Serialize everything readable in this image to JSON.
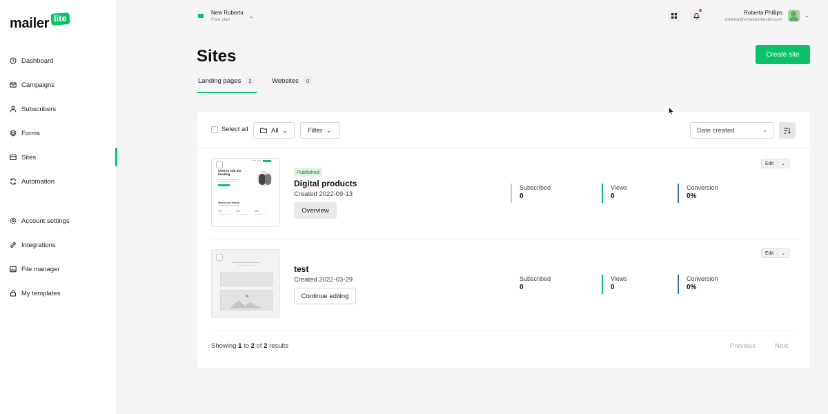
{
  "logo": {
    "text": "mailer",
    "badge": "lite"
  },
  "sidebar": {
    "items": [
      {
        "label": "Dashboard",
        "icon": "clock-icon"
      },
      {
        "label": "Campaigns",
        "icon": "mail-icon"
      },
      {
        "label": "Subscribers",
        "icon": "user-icon"
      },
      {
        "label": "Forms",
        "icon": "layers-icon"
      },
      {
        "label": "Sites",
        "icon": "browser-icon"
      },
      {
        "label": "Automation",
        "icon": "refresh-icon"
      },
      {
        "label": "Account settings",
        "icon": "gear-icon"
      },
      {
        "label": "Integrations",
        "icon": "link-icon"
      },
      {
        "label": "File manager",
        "icon": "image-icon"
      },
      {
        "label": "My templates",
        "icon": "lock-icon"
      }
    ],
    "active": "Sites"
  },
  "workspace": {
    "name": "New Roberta",
    "plan": "Free plan"
  },
  "user": {
    "name": "Roberta Phillips",
    "email": "roberta@emailtooltester.com"
  },
  "page": {
    "title": "Sites",
    "create_button": "Create site"
  },
  "tabs": [
    {
      "label": "Landing pages",
      "count": "2",
      "active": true
    },
    {
      "label": "Websites",
      "count": "0",
      "active": false
    }
  ],
  "toolbar": {
    "select_all": "Select all",
    "folder_filter": "All",
    "filter": "Filter",
    "sort_select": "Date created"
  },
  "sites": [
    {
      "status": "Published",
      "name": "Digital products",
      "created": "Created 2022-09-13",
      "action": "Overview",
      "stats": [
        {
          "label": "Subscribed",
          "value": "0"
        },
        {
          "label": "Views",
          "value": "0"
        },
        {
          "label": "Conversion",
          "value": "0%"
        }
      ],
      "edit": "Edit",
      "thumb_heading": "Click to edit the heading",
      "thumb_sub": "How to use blocks"
    },
    {
      "status": "",
      "name": "test",
      "created": "Created 2022-03-29",
      "action": "Continue editing",
      "stats": [
        {
          "label": "Subscribed",
          "value": "0"
        },
        {
          "label": "Views",
          "value": "0"
        },
        {
          "label": "Conversion",
          "value": "0%"
        }
      ],
      "edit": "Edit"
    }
  ],
  "footer": {
    "showing_prefix": "Showing",
    "from": "1",
    "to_word": "to",
    "to": "2",
    "of_word": "of",
    "total": "2",
    "results_word": "results",
    "previous": "Previous",
    "next": "Next"
  },
  "colors": {
    "accent": "#09c269",
    "stat_views": "#09c269",
    "stat_conversion": "#3a6fb0",
    "stat_subscribed": "#c8c8c8"
  }
}
